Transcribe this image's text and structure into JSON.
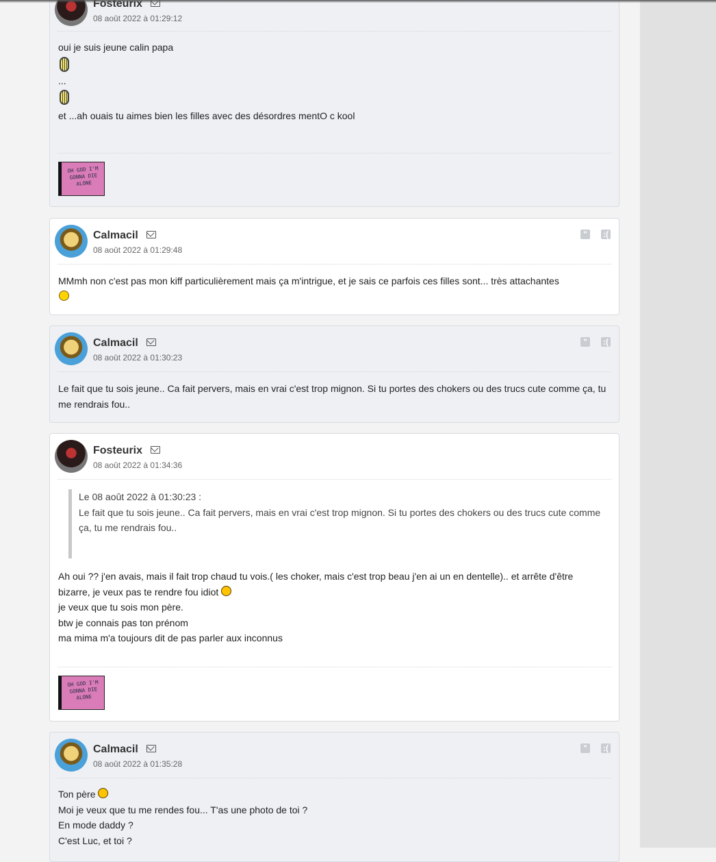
{
  "posts": [
    {
      "author": "Fosteurix",
      "date": "08 août 2022 à 01:29:12",
      "lines": [
        "oui je suis jeune calin papa",
        "...",
        "et ...ah ouais tu aimes bien les filles avec des désordres mentO c kool"
      ],
      "signature_text": "OH GOD I'M GONNA DIE ALONE"
    },
    {
      "author": "Calmacil",
      "date": "08 août 2022 à 01:29:48",
      "text": "MMmh non c'est pas mon kiff particulièrement mais ça m'intrigue, et je sais ce parfois ces filles sont... très attachantes"
    },
    {
      "author": "Calmacil",
      "date": "08 août 2022 à 01:30:23",
      "text": "Le fait que tu sois jeune.. Ca fait pervers, mais en vrai c'est trop mignon. Si tu portes des chokers ou des trucs cute comme ça, tu me rendrais fou.."
    },
    {
      "author": "Fosteurix",
      "date": "08 août 2022 à 01:34:36",
      "quote_header": "Le 08 août 2022 à 01:30:23 :",
      "quote_text": "Le fait que tu sois jeune.. Ca fait pervers, mais en vrai c'est trop mignon. Si tu portes des chokers ou des trucs cute comme ça, tu me rendrais fou..",
      "text_intro": "Ah oui ?? j'en avais, mais il fait trop chaud tu vois.( les choker, mais c'est trop beau j'en ai un en dentelle).. et arrête d'être bizarre, je veux pas te rendre fou idiot",
      "lines": [
        "je veux que tu sois mon père.",
        "btw je connais pas ton prénom",
        "ma mima m'a toujours dit de pas parler aux inconnus"
      ],
      "signature_text": "OH GOD I'M GONNA DIE ALONE"
    },
    {
      "author": "Calmacil",
      "date": "08 août 2022 à 01:35:28",
      "first_line": "Ton père",
      "lines": [
        "Moi je veux que tu me rendes fou... T'as une photo de toi ?",
        "En mode daddy ?",
        "C'est Luc, et toi ?"
      ]
    }
  ],
  "icons": {
    "quote": "quote-icon",
    "report": "report-icon",
    "mail": "mail-icon"
  }
}
